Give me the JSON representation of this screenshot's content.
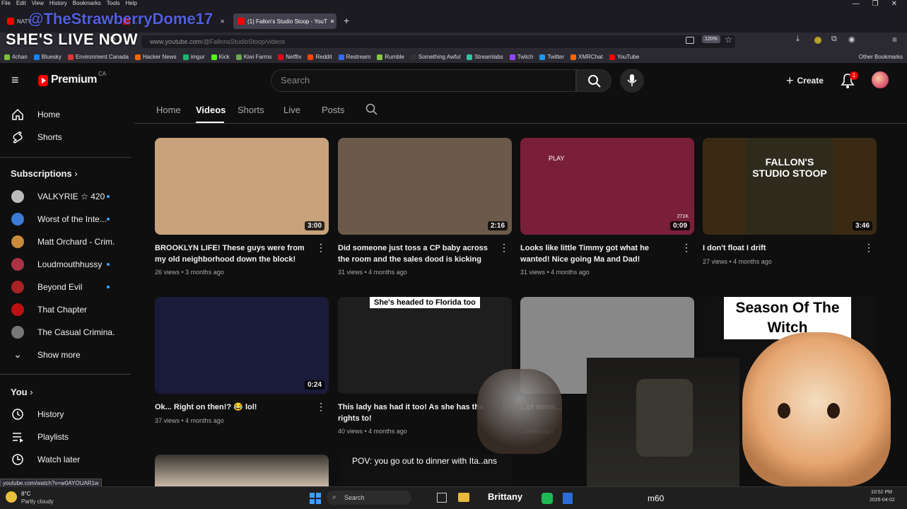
{
  "menubar": {
    "items": [
      "File",
      "Edit",
      "View",
      "History",
      "Bookmarks",
      "Tools",
      "Help"
    ]
  },
  "overlay": {
    "handle": "@TheStrawberryDome17",
    "title": "SHE'S LIVE NOW",
    "stream_label_1": "Brittany",
    "stream_label_2": "m60"
  },
  "browser": {
    "tabs": [
      {
        "label": "NATV ...",
        "active": false
      },
      {
        "label": "...",
        "active": false
      },
      {
        "label": "(1) Fallon's Studio Stoop - YouT",
        "active": true
      }
    ],
    "url_prefix": "www.youtube.com",
    "url_path": "/@FallonsStudioStoop/videos",
    "zoom": "120%",
    "bookmarks": [
      {
        "label": "4chan",
        "color": "#7bbf3a"
      },
      {
        "label": "Bluesky",
        "color": "#1185fe"
      },
      {
        "label": "Environment Canada",
        "color": "#d33"
      },
      {
        "label": "Hacker News",
        "color": "#ff6600"
      },
      {
        "label": "imgur",
        "color": "#1bb76e"
      },
      {
        "label": "Kick",
        "color": "#53fc18"
      },
      {
        "label": "Kiwi Farms",
        "color": "#6aa84f"
      },
      {
        "label": "Netflix",
        "color": "#e50914"
      },
      {
        "label": "Reddit",
        "color": "#ff4500"
      },
      {
        "label": "Restream",
        "color": "#2f6bff"
      },
      {
        "label": "Rumble",
        "color": "#85c742"
      },
      {
        "label": "Something Awful",
        "color": "#333"
      },
      {
        "label": "Streamlabs",
        "color": "#31c3a2"
      },
      {
        "label": "Twitch",
        "color": "#9146ff"
      },
      {
        "label": "Twitter",
        "color": "#1d9bf0"
      },
      {
        "label": "XMRChat",
        "color": "#f60"
      },
      {
        "label": "YouTube",
        "color": "#f00"
      }
    ],
    "other_bookmarks": "Other Bookmarks",
    "status_url": "youtube.com/watch?v=w0AYOUAR1w"
  },
  "youtube": {
    "logo_text": "Premium",
    "region": "CA",
    "search_placeholder": "Search",
    "create_label": "Create",
    "notif_count": "1",
    "sidebar": {
      "main": [
        {
          "label": "Home",
          "icon": "home-icon"
        },
        {
          "label": "Shorts",
          "icon": "shorts-icon"
        }
      ],
      "subscriptions_header": "Subscriptions",
      "subscriptions": [
        {
          "label": "VALKYRIE ☆ 420",
          "dot": true,
          "color": "#bbb"
        },
        {
          "label": "Worst of the Inte...",
          "dot": true,
          "color": "#3a7bd5"
        },
        {
          "label": "Matt Orchard - Crim...",
          "dot": false,
          "color": "#c98a3a"
        },
        {
          "label": "Loudmouthhussy",
          "dot": true,
          "color": "#a34"
        },
        {
          "label": "Beyond Evil",
          "dot": true,
          "color": "#a22"
        },
        {
          "label": "That Chapter",
          "dot": false,
          "color": "#b11"
        },
        {
          "label": "The Casual Crimina...",
          "dot": false,
          "color": "#777"
        }
      ],
      "show_more": "Show more",
      "you_header": "You",
      "you_items": [
        {
          "label": "History",
          "icon": "history-icon"
        },
        {
          "label": "Playlists",
          "icon": "playlists-icon"
        },
        {
          "label": "Watch later",
          "icon": "watch-later-icon"
        }
      ]
    },
    "channel_tabs": [
      "Home",
      "Videos",
      "Shorts",
      "Live",
      "Posts"
    ],
    "videos": [
      {
        "title": "BROOKLYN LIFE! These guys were from my old neighborhood down the block! Still...",
        "views": "26 views",
        "age": "3 months ago",
        "duration": "3:00",
        "bg": "#c7a27a"
      },
      {
        "title": "Did someone just toss a CP baby across the room and the sales dood is kicking them o...",
        "views": "31 views",
        "age": "4 months ago",
        "duration": "2:16",
        "bg": "#6b5a4a"
      },
      {
        "title": "Looks like little Timmy got what he wanted! Nice going Ma and Dad!",
        "views": "31 views",
        "age": "4 months ago",
        "duration": "0:09",
        "bg": "#7a1f3a",
        "thumb_text": "PLAY",
        "likes": "271K"
      },
      {
        "title": "I don't float I drift",
        "views": "27 views",
        "age": "4 months ago",
        "duration": "3:46",
        "bg": "#3a2a14",
        "thumb_text": "FALLON'S STUDIO STOOP"
      },
      {
        "title": "Ok... Right on then!? 😂 lol!",
        "views": "37 views",
        "age": "4 months ago",
        "duration": "0:24",
        "bg": "#1a1a3a"
      },
      {
        "title": "This lady has had it too! As she has the rights to!",
        "views": "40 views",
        "age": "4 months ago",
        "duration": "",
        "bg": "#1e1e1e",
        "thumb_text": "She's headed to Florida too"
      },
      {
        "title": "...ct norm...",
        "views": "",
        "age": "...onths ago",
        "duration": "",
        "bg": "#888"
      },
      {
        "title": "",
        "views": "",
        "age": "",
        "duration": "",
        "bg": "#111",
        "thumb_text": "Season Of The Witch"
      }
    ],
    "row3_caption": "POV: you go out to dinner with Ita..ans"
  },
  "taskbar": {
    "temp": "8°C",
    "weather": "Partly cloudy",
    "search": "Search",
    "time": "10:52 PM",
    "date": "2026-04-02"
  }
}
